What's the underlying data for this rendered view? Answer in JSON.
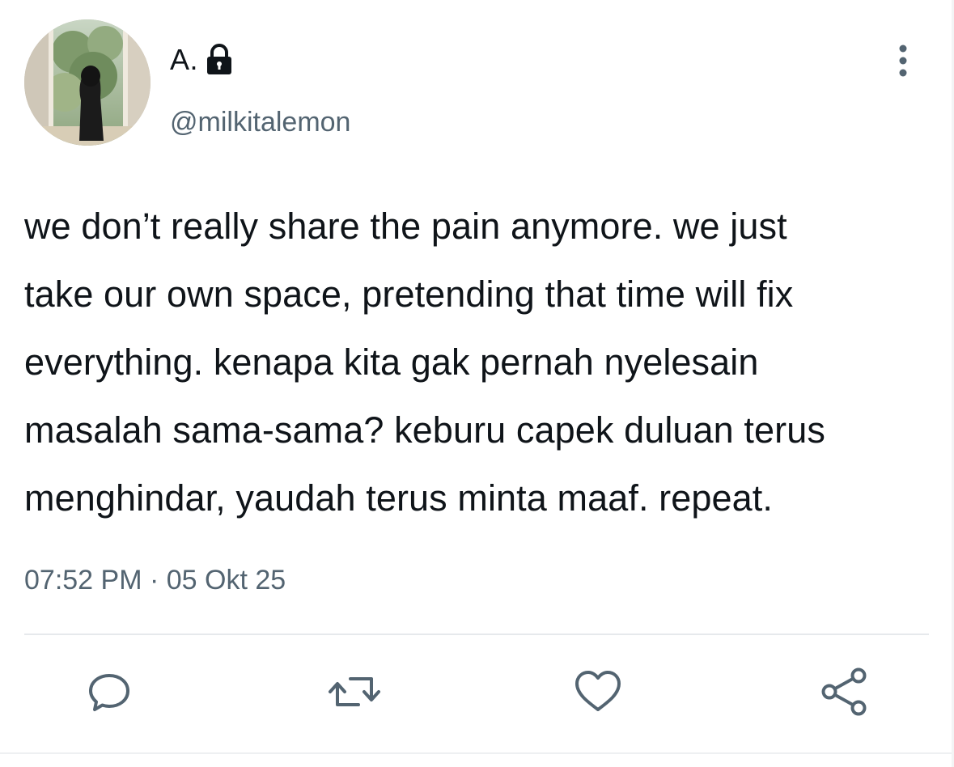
{
  "author": {
    "display_name": "A.",
    "handle": "@milkitalemon",
    "protected_icon": "lock-icon",
    "avatar_icon": "profile-photo"
  },
  "tweet": {
    "text": "we don’t really share the pain anymore. we just\ntake our own space, pretending that time will fix\neverything. kenapa kita gak pernah nyelesain\nmasalah sama-sama? keburu capek duluan terus\nmenghindar, yaudah terus minta maaf. repeat.",
    "timestamp": "07:52 PM · 05 Okt 25"
  },
  "actions": [
    {
      "name": "reply",
      "icon": "comment-icon"
    },
    {
      "name": "retweet",
      "icon": "retweet-icon"
    },
    {
      "name": "like",
      "icon": "heart-icon"
    },
    {
      "name": "share",
      "icon": "share-icon"
    }
  ],
  "colors": {
    "text": "#0f1419",
    "secondary": "#536471",
    "divider": "#e6e9ec",
    "icon": "#536471"
  }
}
